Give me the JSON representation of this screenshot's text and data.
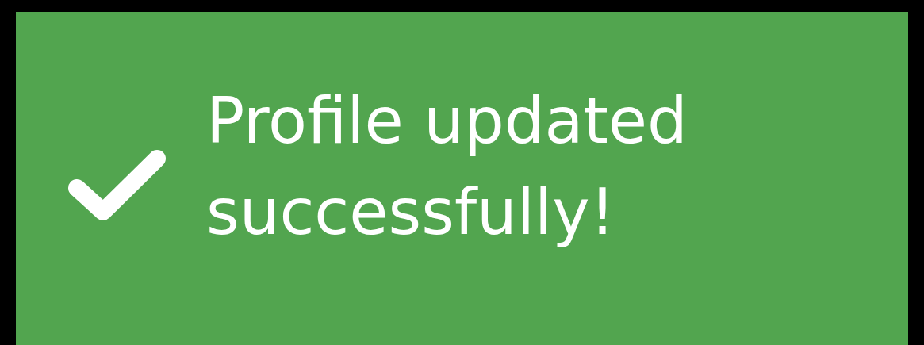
{
  "toast": {
    "kind": "success",
    "message": "Profile updated successfully!"
  }
}
